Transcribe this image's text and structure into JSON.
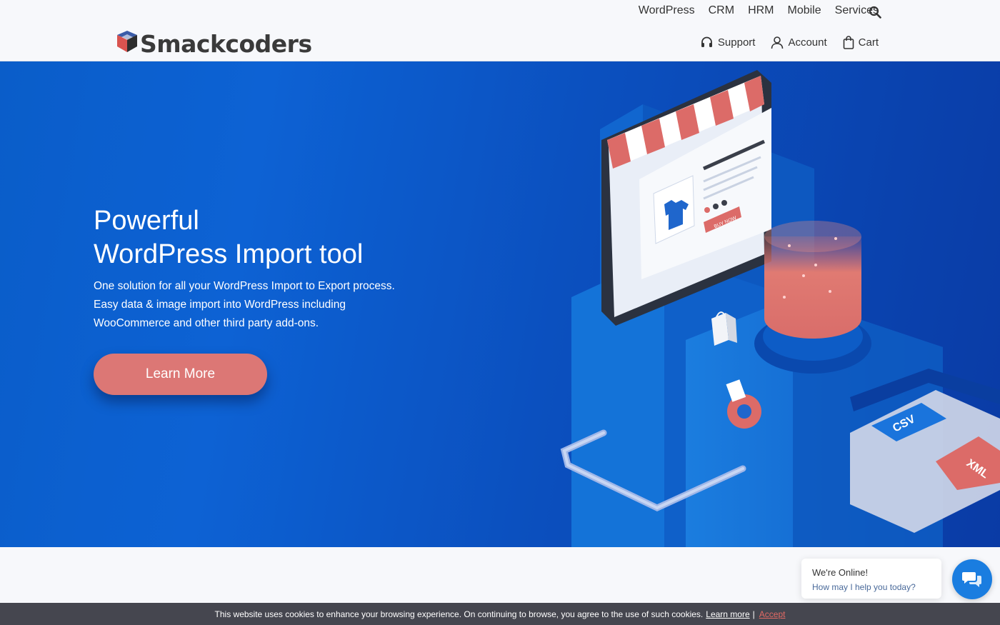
{
  "brand": {
    "name": "Smackcoders"
  },
  "top_nav": [
    "WordPress",
    "CRM",
    "HRM",
    "Mobile",
    "Services"
  ],
  "sub_nav": {
    "support": "Support",
    "account": "Account",
    "cart": "Cart"
  },
  "hero": {
    "title_line1": "Powerful",
    "title_line2": "WordPress Import tool",
    "sub_line1": "One solution for all your WordPress Import to Export process.",
    "sub_line2": "Easy data & image import into WordPress including",
    "sub_line3": "WooCommerce and other third party add-ons.",
    "cta": "Learn More",
    "illustration_labels": {
      "buy": "BUY NOW",
      "csv": "CSV",
      "xml": "XML"
    }
  },
  "chat": {
    "line1": "We're Online!",
    "line2": "How may I help you today?"
  },
  "cookie": {
    "text": "This website uses cookies to enhance your browsing experience. On continuing to browse, you agree to the use of such cookies.",
    "learn_more": "Learn more",
    "separator": "|",
    "accept": "Accept"
  },
  "colors": {
    "hero_blue": "#0b50bf",
    "cta_red": "#dc7775",
    "cookie_bar": "#45464f",
    "chat_blue": "#1a7de0"
  }
}
